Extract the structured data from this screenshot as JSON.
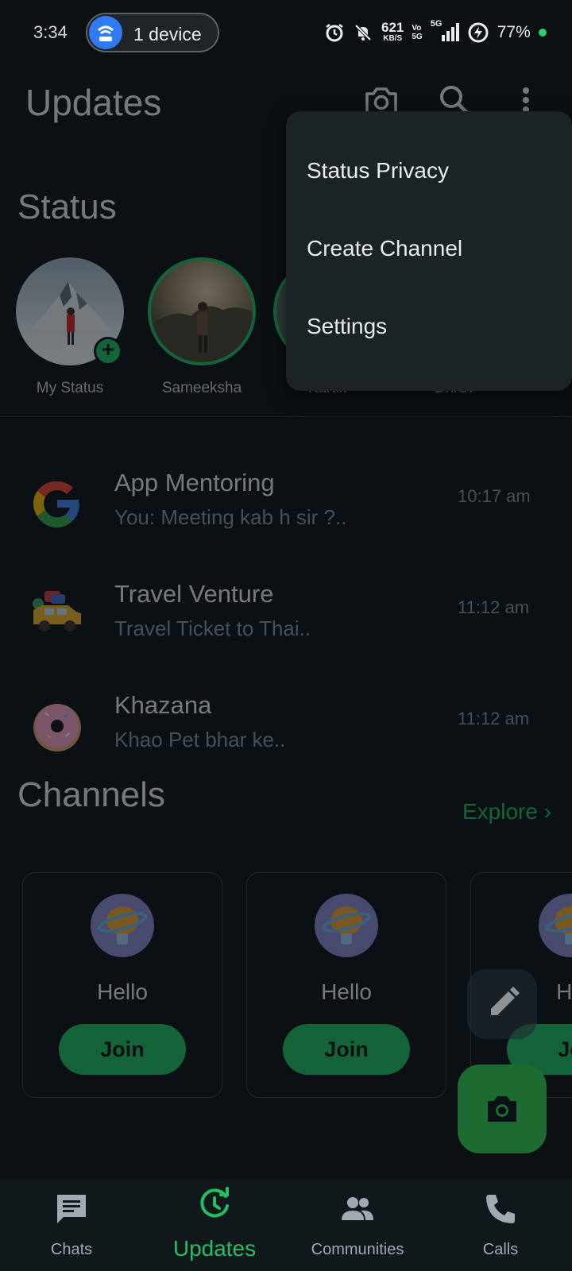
{
  "status_bar": {
    "time": "3:34",
    "device_label": "1 device",
    "speed_value": "621",
    "speed_unit": "KB/S",
    "vo_top": "Vo",
    "vo_bottom": "5G",
    "network": "5G",
    "battery": "77%"
  },
  "header": {
    "title": "Updates",
    "icons": [
      "camera-icon",
      "search-icon",
      "more-vert-icon"
    ]
  },
  "status": {
    "title": "Status",
    "items": [
      {
        "name": "My Status"
      },
      {
        "name": "Sameeksha"
      },
      {
        "name": "Kartik"
      },
      {
        "name": "Dhruv"
      }
    ]
  },
  "chats": [
    {
      "name": "App Mentoring",
      "message": "You: Meeting kab h sir ?..",
      "time": "10:17 am",
      "icon": "google-icon"
    },
    {
      "name": "Travel Venture",
      "message": "Travel Ticket to Thai..",
      "time": "11:12 am",
      "icon": "car-icon"
    },
    {
      "name": "Khazana",
      "message": "Khao Pet bhar ke..",
      "time": "11:12 am",
      "icon": "donut-icon"
    }
  ],
  "channels": {
    "title": "Channels",
    "explore_label": "Explore",
    "cards": [
      {
        "name": "Hello",
        "button": "Join"
      },
      {
        "name": "Hello",
        "button": "Join"
      },
      {
        "name": "He",
        "button": "Jo"
      }
    ]
  },
  "menu": {
    "items": [
      "Status Privacy",
      "Create Channel",
      "Settings"
    ]
  },
  "bottom_nav": {
    "items": [
      {
        "label": "Chats",
        "icon": "chat-icon"
      },
      {
        "label": "Updates",
        "icon": "updates-icon"
      },
      {
        "label": "Communities",
        "icon": "communities-icon"
      },
      {
        "label": "Calls",
        "icon": "phone-icon"
      }
    ],
    "active": "Updates"
  },
  "colors": {
    "accent": "#21c063",
    "background": "#0b1014",
    "menu_bg": "#1c2326"
  }
}
